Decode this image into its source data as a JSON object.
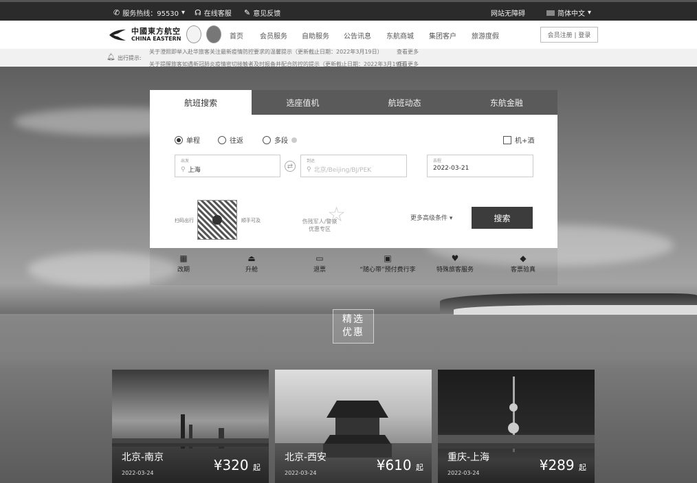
{
  "topbar": {
    "hotline": "服务热线：95530",
    "online_service": "在线客服",
    "feedback": "意见反馈",
    "accessibility": "网站无障碍",
    "language": "简体中文"
  },
  "nav": {
    "logo_cn": "中國東方航空",
    "logo_en": "CHINA EASTERN",
    "menu": [
      "首页",
      "会员服务",
      "自助服务",
      "公告讯息",
      "东航商城",
      "集团客户",
      "旅游度假"
    ],
    "login": "会员注册 | 登录"
  },
  "notice": {
    "label": "出行提示:",
    "line1": "关于澄照即举入赴华旅客关注最新疫情防控要求的温馨提示（更新截止日期：2022年3月19日）",
    "line2": "关于提醒旅客如遇新冠肺炎疫情密切接触者及时报备并配合防控的提示（更新截止日期：2022年3月19日）",
    "more1": "查看更多",
    "more2": "查看更多"
  },
  "search": {
    "tabs": [
      "航班搜索",
      "选座值机",
      "航班动态",
      "东航金融"
    ],
    "active_tab": 0,
    "trip_types": [
      "单程",
      "往返",
      "多段"
    ],
    "hotel_combo": "机+酒",
    "from_label": "出发",
    "from_value": "上海",
    "to_label": "到达",
    "to_placeholder": "北京/Beijing/BJ/PEK",
    "date_label": "去程",
    "date_value": "2022-03-21",
    "qr_left": "扫码出行",
    "qr_right": "顺手可及",
    "veteran_line1": "伤残军人/警察",
    "veteran_line2": "优惠专区",
    "more_conditions": "更多高级条件",
    "search_button": "搜索"
  },
  "services": [
    "改期",
    "升舱",
    "退票",
    "“随心带”预付费行李",
    "特殊旅客服务",
    "客票验真"
  ],
  "promo": {
    "line1": "精选",
    "line2": "优惠"
  },
  "deals": [
    {
      "route": "北京-南京",
      "date": "2022-03-24",
      "price": "¥320",
      "suffix": "起"
    },
    {
      "route": "北京-西安",
      "date": "2022-03-24",
      "price": "¥610",
      "suffix": "起"
    },
    {
      "route": "重庆-上海",
      "date": "2022-03-24",
      "price": "¥289",
      "suffix": "起"
    }
  ]
}
